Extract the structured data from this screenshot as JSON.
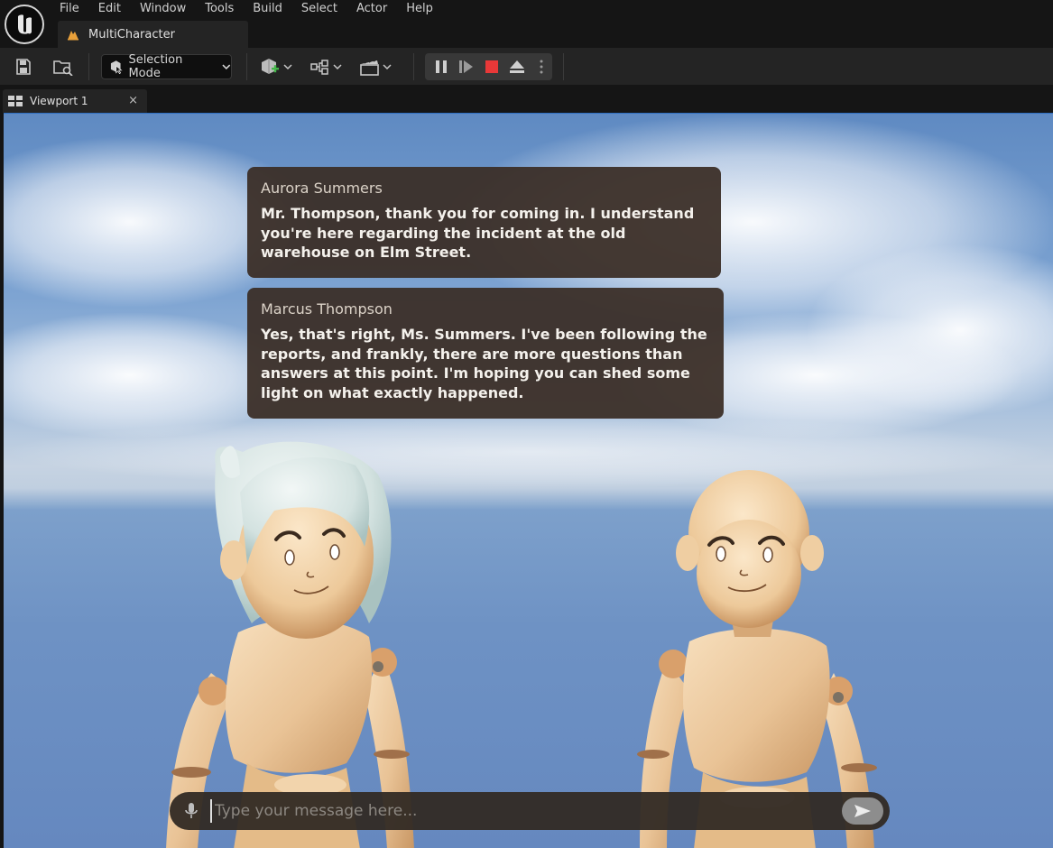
{
  "menu": {
    "items": [
      "File",
      "Edit",
      "Window",
      "Tools",
      "Build",
      "Select",
      "Actor",
      "Help"
    ]
  },
  "project_tab": {
    "label": "MultiCharacter",
    "icon": "level-icon"
  },
  "toolbar": {
    "mode_label": "Selection Mode",
    "icons": [
      "save-icon",
      "content-browser-icon",
      "selection-mode-icon",
      "add-actor-icon",
      "blueprints-icon",
      "cinematics-icon",
      "pause-icon",
      "frame-skip-icon",
      "stop-icon",
      "eject-icon",
      "more-options-icon"
    ],
    "colors": {
      "stop": "#e83838",
      "background": "#242424"
    }
  },
  "viewport_tab": {
    "label": "Viewport 1",
    "close": "×"
  },
  "dialogue": [
    {
      "speaker": "Aurora Summers",
      "text": "Mr. Thompson, thank you for coming in. I understand you're here regarding the incident at the old warehouse on Elm Street."
    },
    {
      "speaker": "Marcus Thompson",
      "text": "Yes, that's right, Ms. Summers. I've been following the reports, and frankly, there are more questions than answers at this point. I'm hoping you can shed some light on what exactly happened."
    }
  ],
  "chat": {
    "placeholder": "Type your message here...",
    "value": ""
  }
}
